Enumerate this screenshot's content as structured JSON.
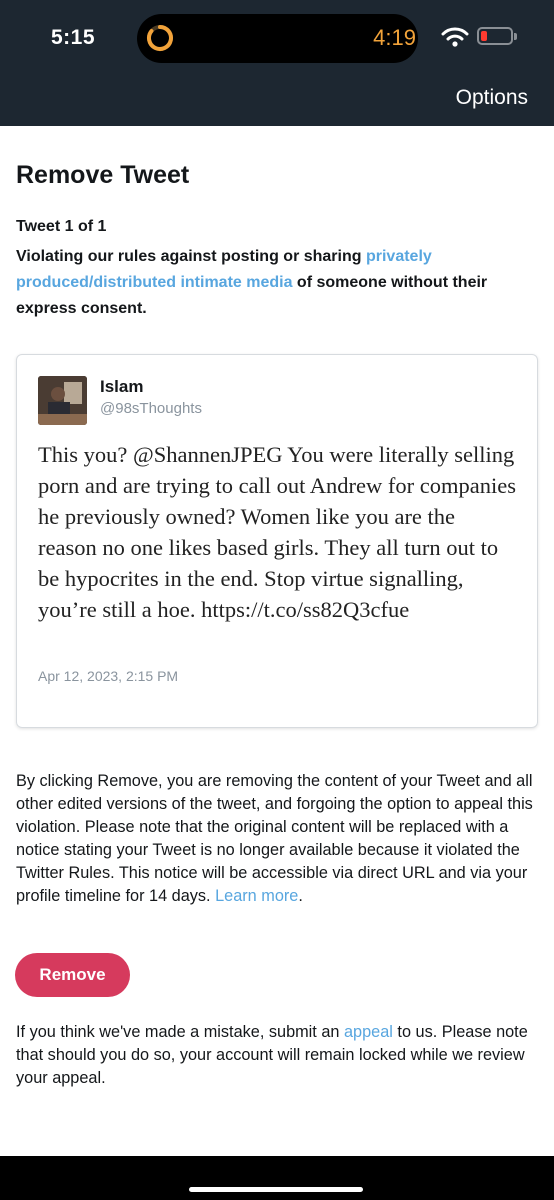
{
  "status_bar": {
    "time": "5:15",
    "timer": "4:19",
    "timer_color": "#f2a33a",
    "wifi_icon": "wifi-icon",
    "battery_icon": "battery-icon",
    "battery_level": 0.15
  },
  "nav": {
    "options_label": "Options"
  },
  "page": {
    "title": "Remove Tweet",
    "tweet_count": "Tweet 1 of 1",
    "violation_prefix": "Violating our rules against posting or sharing ",
    "violation_link": "privately produced/distributed intimate media",
    "violation_suffix": " of someone without their express consent."
  },
  "tweet": {
    "avatar_icon": "avatar-photo",
    "author_name": "Islam",
    "author_handle": "@98sThoughts",
    "text": "This you? @ShannenJPEG You were literally selling porn and are trying to call out Andrew for companies he previously owned? Women like you are the reason no one likes based girls. They all turn out to be hypocrites in the end. Stop virtue signalling, you’re still a hoe. https://t.co/ss82Q3cfue",
    "date": "Apr 12, 2023, 2:15 PM"
  },
  "explanation": {
    "text": "By clicking Remove, you are removing the content of your Tweet and all other edited versions of the tweet, and forgoing the option to appeal this violation. Please note that the original content will be replaced with a notice stating your Tweet is no longer available because it violated the Twitter Rules. This notice will be accessible via direct URL and via your profile timeline for 14 days. ",
    "learn_more": "Learn more",
    "period": "."
  },
  "remove_button": {
    "label": "Remove",
    "color": "#d63a5d"
  },
  "appeal": {
    "prefix": "If you think we've made a mistake, submit an ",
    "link": "appeal",
    "suffix": " to us. Please note that should you do so, your account will remain locked while we review your appeal."
  },
  "colors": {
    "header_bg": "#1d2731",
    "link": "#58a6df"
  }
}
